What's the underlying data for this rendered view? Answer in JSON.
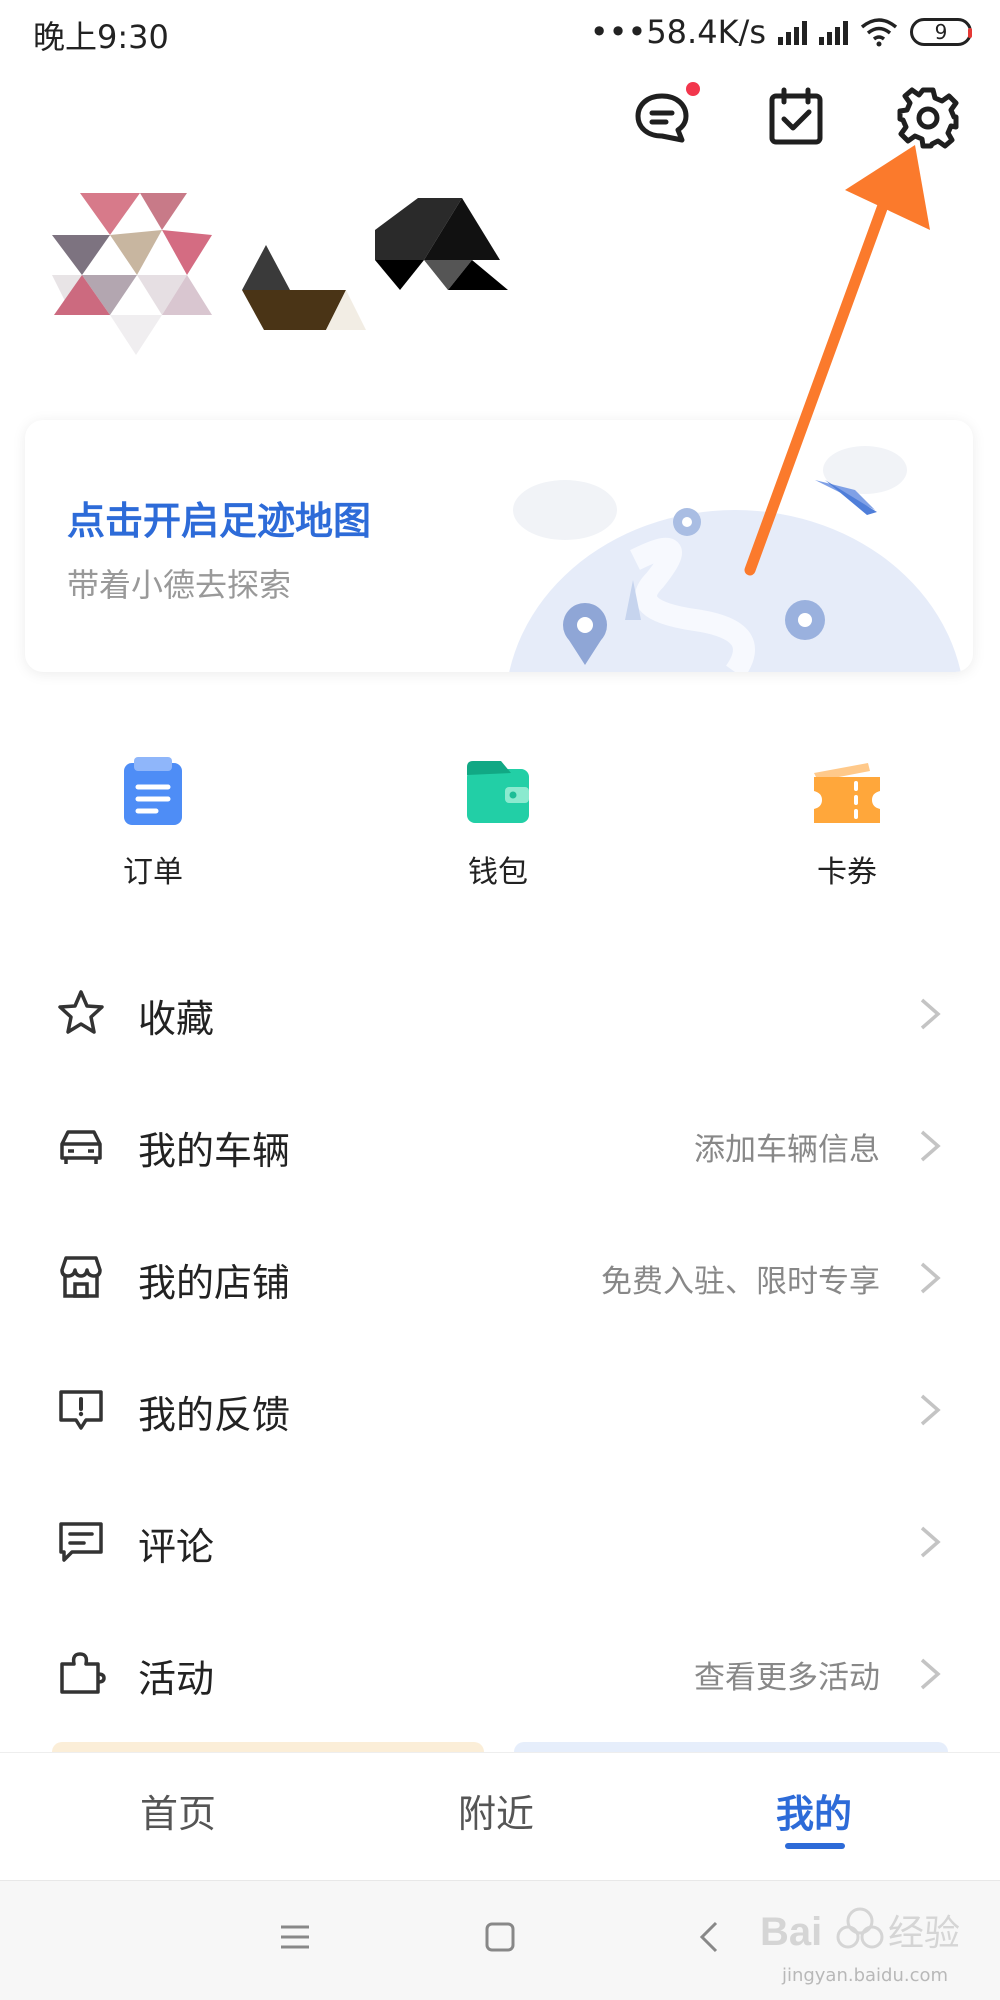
{
  "status_bar": {
    "time": "晚上9:30",
    "net_speed": "•••58.4K/s",
    "battery": "9"
  },
  "header": {
    "icons": [
      "message-icon",
      "task-check-icon",
      "gear-icon"
    ]
  },
  "footprint_card": {
    "title": "点击开启足迹地图",
    "subtitle": "带着小德去探索"
  },
  "quick_entries": [
    {
      "label": "订单",
      "icon": "order-icon",
      "color": "#4e8df6"
    },
    {
      "label": "钱包",
      "icon": "wallet-icon",
      "color": "#22cfa6"
    },
    {
      "label": "卡券",
      "icon": "coupon-icon",
      "color": "#ffa73b"
    }
  ],
  "menu": [
    {
      "label": "收藏",
      "hint": "",
      "icon": "star-icon"
    },
    {
      "label": "我的车辆",
      "hint": "添加车辆信息",
      "icon": "car-icon"
    },
    {
      "label": "我的店铺",
      "hint": "免费入驻、限时专享",
      "icon": "store-icon"
    },
    {
      "label": "我的反馈",
      "hint": "",
      "icon": "feedback-icon"
    },
    {
      "label": "评论",
      "hint": "",
      "icon": "comment-icon"
    },
    {
      "label": "活动",
      "hint": "查看更多活动",
      "icon": "puzzle-icon"
    }
  ],
  "tabs": [
    {
      "label": "首页"
    },
    {
      "label": "附近"
    },
    {
      "label": "我的",
      "active": true
    }
  ],
  "watermark": {
    "text": "jingyan.baidu.com"
  },
  "colors": {
    "accent": "#2d6bd8",
    "annotation_arrow": "#fb7a2c",
    "notification_dot": "#f2364c"
  }
}
